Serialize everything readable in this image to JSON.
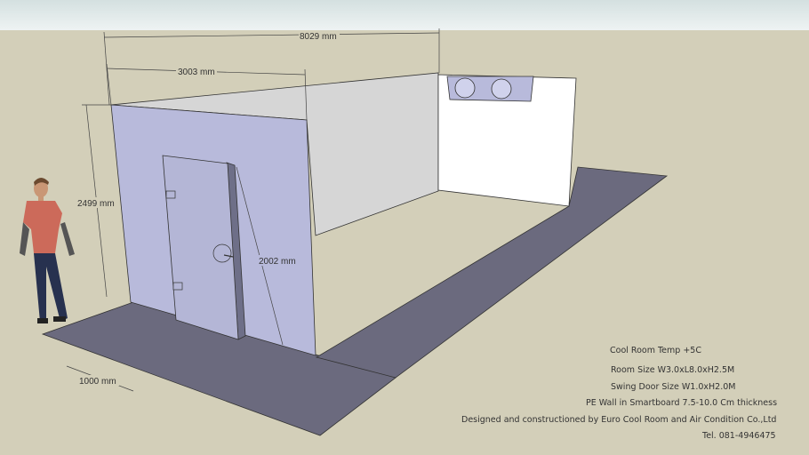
{
  "dimensions": {
    "total_length": "8029 mm",
    "width": "3003 mm",
    "height": "2499 mm",
    "door_height": "2002 mm",
    "pad_width": "1000 mm"
  },
  "notes": {
    "temp": "Cool Room Temp +5C",
    "room_size": "Room Size W3.0xL8.0xH2.5M",
    "door_size": "Swing Door Size W1.0xH2.0M",
    "wall": "PE Wall in Smartboard 7.5-10.0 Cm thickness",
    "designer": "Designed and constructioned by Euro Cool Room and Air Condition Co.,Ltd",
    "tel": "Tel. 081-4946475"
  },
  "colors": {
    "sky": "#dde6e6",
    "ground": "#d3cfb9",
    "shadow": "#6b6a7e",
    "front_wall": "#b8badb",
    "back_wall": "#ffffff",
    "side_wall": "#d6d6d6"
  }
}
